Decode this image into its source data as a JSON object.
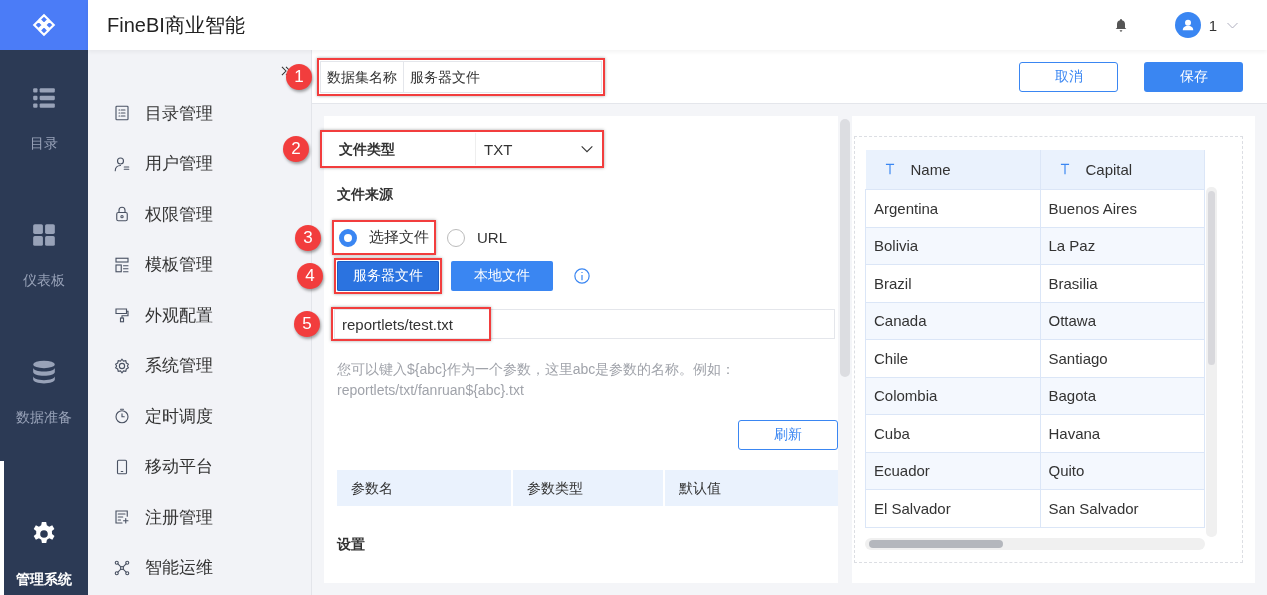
{
  "nav": {
    "items": [
      {
        "label": "目录",
        "selected": false
      },
      {
        "label": "仪表板",
        "selected": false
      },
      {
        "label": "数据准备",
        "selected": false
      },
      {
        "label": "管理系统",
        "selected": true
      }
    ]
  },
  "header": {
    "title": "FineBI商业智能",
    "user": "1"
  },
  "menu": {
    "items": [
      {
        "label": "目录管理"
      },
      {
        "label": "用户管理"
      },
      {
        "label": "权限管理"
      },
      {
        "label": "模板管理"
      },
      {
        "label": "外观配置"
      },
      {
        "label": "系统管理"
      },
      {
        "label": "定时调度"
      },
      {
        "label": "移动平台"
      },
      {
        "label": "注册管理"
      },
      {
        "label": "智能运维"
      }
    ]
  },
  "dataset": {
    "label": "数据集名称",
    "value": "服务器文件",
    "callout": "1"
  },
  "actions": [
    {
      "label": "取消",
      "kind": "secondary"
    },
    {
      "label": "保存",
      "kind": "primary"
    }
  ],
  "file_type": {
    "label": "文件类型",
    "value": "TXT",
    "callout": "2"
  },
  "file_source": {
    "title": "文件来源",
    "options": [
      {
        "label": "选择文件",
        "selected": true,
        "callout": "3"
      },
      {
        "label": "URL",
        "selected": false
      }
    ]
  },
  "source_buttons": [
    {
      "label": "服务器文件",
      "selected": true,
      "callout": "4"
    },
    {
      "label": "本地文件",
      "selected": false
    }
  ],
  "path": {
    "value": "reportlets/test.txt",
    "callout": "5"
  },
  "hint": "您可以键入${abc}作为一个参数，这里abc是参数的名称。例如：reportlets/txt/fanruan${abc}.txt",
  "refresh": "刷新",
  "params": {
    "columns": [
      "参数名",
      "参数类型",
      "默认值"
    ]
  },
  "settings": "设置",
  "preview": {
    "columns": [
      "Name",
      "Capital"
    ],
    "rows": [
      [
        "Argentina",
        "Buenos Aires"
      ],
      [
        "Bolivia",
        "La Paz"
      ],
      [
        "Brazil",
        "Brasilia"
      ],
      [
        "Canada",
        "Ottawa"
      ],
      [
        "Chile",
        "Santiago"
      ],
      [
        "Colombia",
        "Bagota"
      ],
      [
        "Cuba",
        "Havana"
      ],
      [
        "Ecuador",
        "Quito"
      ],
      [
        "El Salvador",
        "San Salvador"
      ]
    ]
  }
}
